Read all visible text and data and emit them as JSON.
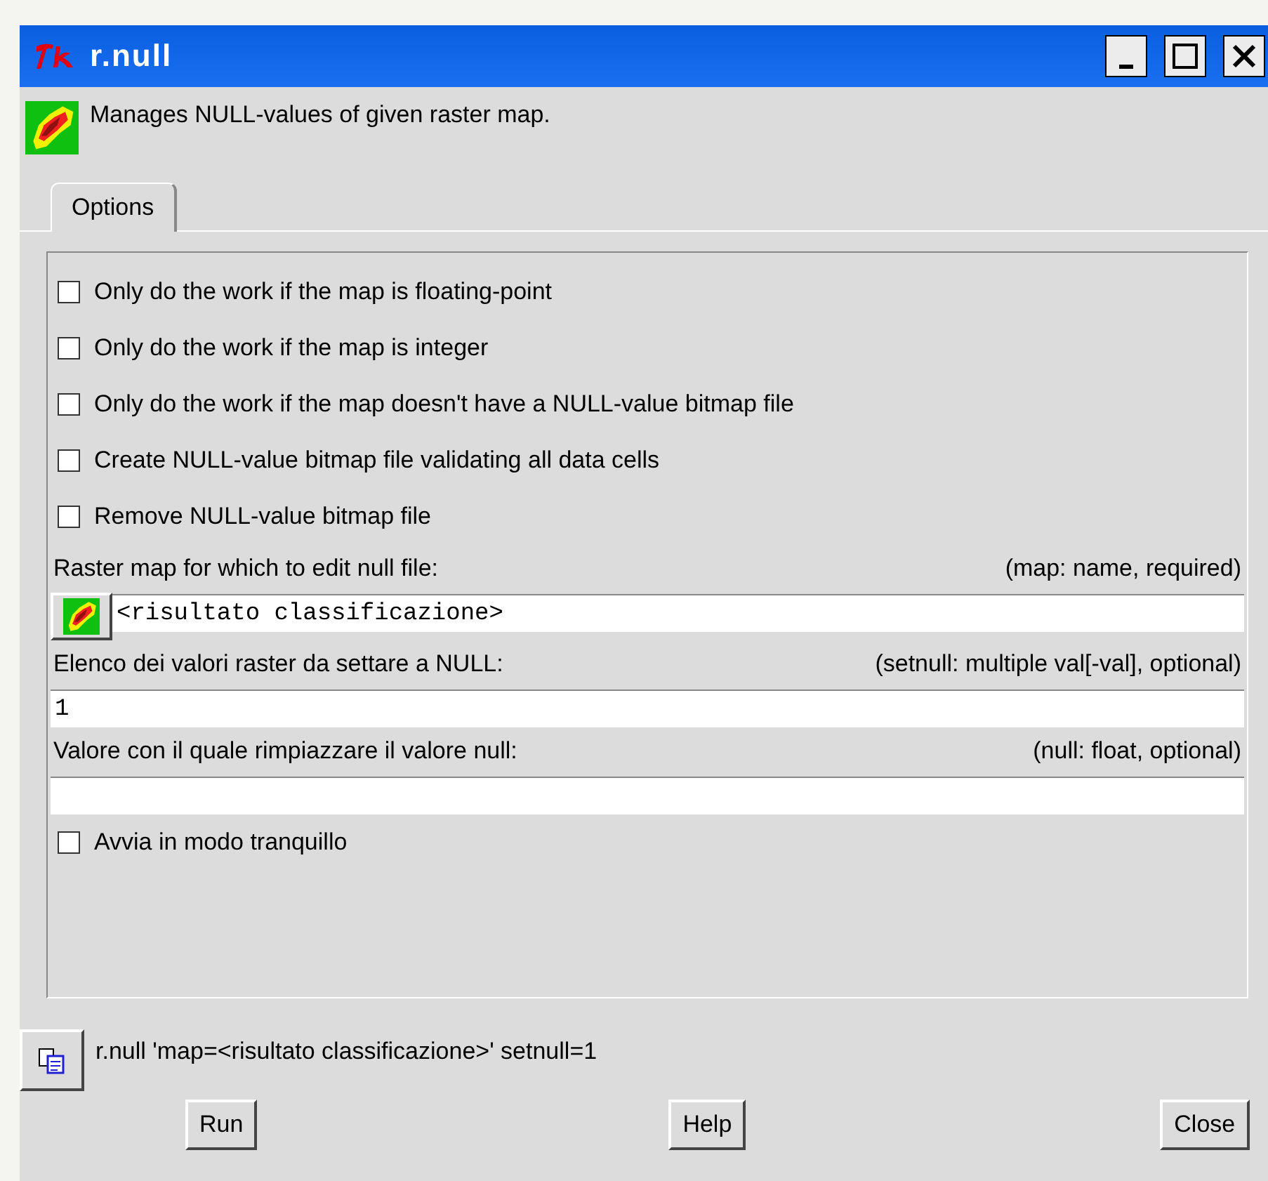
{
  "window": {
    "title": "r.null"
  },
  "description": "Manages NULL-values of given raster map.",
  "tabs": [
    {
      "label": "Options",
      "selected": true
    }
  ],
  "options": [
    {
      "kind": "checkbox",
      "label": "Only do the work if the map is floating-point",
      "checked": false
    },
    {
      "kind": "checkbox",
      "label": "Only do the work if the map is integer",
      "checked": false
    },
    {
      "kind": "checkbox",
      "label": "Only do the work if the map doesn't have a NULL-value bitmap file",
      "checked": false
    },
    {
      "kind": "checkbox",
      "label": "Create NULL-value bitmap file validating all data cells",
      "checked": false
    },
    {
      "kind": "checkbox",
      "label": "Remove NULL-value bitmap file",
      "checked": false
    },
    {
      "kind": "field",
      "label": "Raster map for which to edit null file:",
      "hint": "(map:  name, required)",
      "value": "<risultato classificazione>",
      "map_picker": true
    },
    {
      "kind": "field",
      "label": "Elenco dei valori raster da settare a NULL:",
      "hint": "(setnull: multiple val[-val], optional)",
      "value": "1",
      "map_picker": false
    },
    {
      "kind": "field",
      "label": "Valore con il quale rimpiazzare il valore null:",
      "hint": "(null:  float, optional)",
      "map_picker": false
    },
    {
      "kind": "checkbox",
      "label": "Avvia in modo tranquillo",
      "checked": false
    }
  ],
  "command": "r.null 'map=<risultato classificazione>' setnull=1",
  "buttons": [
    "Run",
    "Help",
    "Close"
  ]
}
